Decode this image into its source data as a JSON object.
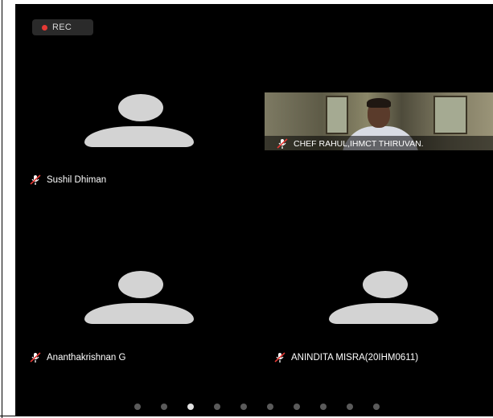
{
  "recording": {
    "label": "REC",
    "dot_color": "#e53935"
  },
  "participants": [
    {
      "name": "Sushil Dhiman",
      "muted": true,
      "video": false
    },
    {
      "name": "CHEF RAHUL,IHMCT THIRUVAN.",
      "muted": true,
      "video": true
    },
    {
      "name": "Ananthakrishnan G",
      "muted": true,
      "video": false
    },
    {
      "name": "ANINDITA MISRA(20IHM0611)",
      "muted": true,
      "video": false
    }
  ],
  "pagination": {
    "total": 10,
    "active_index": 2
  },
  "icons": {
    "mic": "mic-muted-icon",
    "avatar": "avatar-placeholder-icon"
  },
  "colors": {
    "background": "#000000",
    "avatar": "#d3d3d3",
    "text": "#ffffff"
  }
}
